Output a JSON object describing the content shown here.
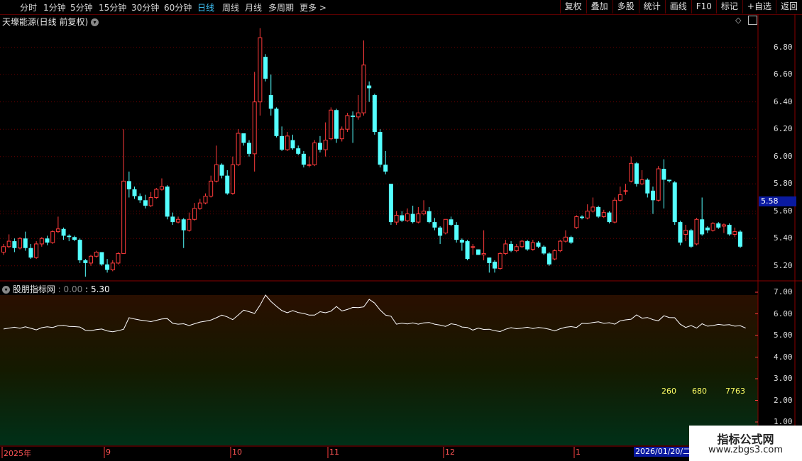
{
  "periods": [
    {
      "label": "分时",
      "active": false
    },
    {
      "label": "1分钟",
      "active": false
    },
    {
      "label": "5分钟",
      "active": false
    },
    {
      "label": "15分钟",
      "active": false
    },
    {
      "label": "30分钟",
      "active": false
    },
    {
      "label": "60分钟",
      "active": false
    },
    {
      "label": "日线",
      "active": true
    },
    {
      "label": "周线",
      "active": false
    },
    {
      "label": "月线",
      "active": false
    },
    {
      "label": "多周期",
      "active": false
    },
    {
      "label": "更多 >",
      "active": false
    }
  ],
  "toolbar_right": [
    "复权",
    "叠加",
    "多股",
    "统计",
    "画线",
    "F10",
    "标记",
    "+自选",
    "返回"
  ],
  "stock_title": "天壕能源(日线 前复权)",
  "price_axis": [
    "6.80",
    "6.60",
    "6.40",
    "6.20",
    "6.00",
    "5.80",
    "5.60",
    "5.40",
    "5.20"
  ],
  "current_price_label": "5.58",
  "indicator": {
    "name": "股朋指标网",
    "value1": "0.00",
    "value2": "5.30"
  },
  "indicator_axis": [
    "7.00",
    "6.00",
    "5.00",
    "4.00",
    "3.00",
    "2.00",
    "1.00"
  ],
  "stats": [
    "260",
    "680",
    "7763"
  ],
  "x_axis": [
    "2025年",
    "9",
    "10",
    "11",
    "12",
    "1"
  ],
  "current_date": "2026/01/20/二",
  "watermark": {
    "line1": "指标公式网",
    "line2": "www.zbgs3.com"
  },
  "colors": {
    "up": "#ff3b3b",
    "down": "#54ffff",
    "line": "#ffffff",
    "accent": "#41c8ff"
  },
  "chart_data": {
    "type": "candlestick",
    "ylim": [
      5.1,
      6.98
    ],
    "indicator_ylim": [
      1.0,
      7.0
    ],
    "candles": [
      [
        5.3,
        5.34,
        5.28,
        5.36
      ],
      [
        5.34,
        5.38,
        5.33,
        5.43
      ],
      [
        5.38,
        5.33,
        5.3,
        5.4
      ],
      [
        5.33,
        5.4,
        5.32,
        5.41
      ],
      [
        5.4,
        5.33,
        5.31,
        5.45
      ],
      [
        5.33,
        5.26,
        5.25,
        5.36
      ],
      [
        5.26,
        5.36,
        5.25,
        5.38
      ],
      [
        5.36,
        5.4,
        5.34,
        5.41
      ],
      [
        5.4,
        5.37,
        5.35,
        5.42
      ],
      [
        5.37,
        5.45,
        5.36,
        5.46
      ],
      [
        5.45,
        5.47,
        5.44,
        5.56
      ],
      [
        5.47,
        5.42,
        5.39,
        5.48
      ],
      [
        5.42,
        5.41,
        5.38,
        5.43
      ],
      [
        5.41,
        5.39,
        5.38,
        5.42
      ],
      [
        5.39,
        5.24,
        5.22,
        5.4
      ],
      [
        5.24,
        5.22,
        5.12,
        5.25
      ],
      [
        5.22,
        5.27,
        5.2,
        5.28
      ],
      [
        5.27,
        5.3,
        5.26,
        5.31
      ],
      [
        5.3,
        5.21,
        5.2,
        5.3
      ],
      [
        5.21,
        5.17,
        5.15,
        5.25
      ],
      [
        5.17,
        5.22,
        5.16,
        5.24
      ],
      [
        5.22,
        5.29,
        5.21,
        5.3
      ],
      [
        5.29,
        5.82,
        5.42,
        6.2
      ],
      [
        5.82,
        5.76,
        5.7,
        5.89
      ],
      [
        5.76,
        5.71,
        5.69,
        5.78
      ],
      [
        5.71,
        5.68,
        5.66,
        5.73
      ],
      [
        5.68,
        5.64,
        5.62,
        5.72
      ],
      [
        5.64,
        5.7,
        5.63,
        5.74
      ],
      [
        5.7,
        5.76,
        5.69,
        5.77
      ],
      [
        5.76,
        5.78,
        5.75,
        5.84
      ],
      [
        5.78,
        5.56,
        5.54,
        5.79
      ],
      [
        5.56,
        5.52,
        5.5,
        5.59
      ],
      [
        5.52,
        5.54,
        5.51,
        5.56
      ],
      [
        5.54,
        5.46,
        5.33,
        5.55
      ],
      [
        5.46,
        5.54,
        5.45,
        5.59
      ],
      [
        5.54,
        5.62,
        5.53,
        5.66
      ],
      [
        5.62,
        5.66,
        5.61,
        5.69
      ],
      [
        5.66,
        5.71,
        5.65,
        5.73
      ],
      [
        5.71,
        5.82,
        5.7,
        5.86
      ],
      [
        5.82,
        5.94,
        5.81,
        6.08
      ],
      [
        5.94,
        5.86,
        5.84,
        5.95
      ],
      [
        5.86,
        5.73,
        5.72,
        5.9
      ],
      [
        5.73,
        5.94,
        5.72,
        6.0
      ],
      [
        5.94,
        6.17,
        5.93,
        6.2
      ],
      [
        6.17,
        6.1,
        6.08,
        6.17
      ],
      [
        6.1,
        6.02,
        6.0,
        6.12
      ],
      [
        6.02,
        6.4,
        5.89,
        6.62
      ],
      [
        6.4,
        6.87,
        6.3,
        6.94
      ],
      [
        6.73,
        6.57,
        6.55,
        6.75
      ],
      [
        6.45,
        6.35,
        6.3,
        6.6
      ],
      [
        6.35,
        6.15,
        6.14,
        6.36
      ],
      [
        6.15,
        6.05,
        6.04,
        6.22
      ],
      [
        6.05,
        6.15,
        6.04,
        6.18
      ],
      [
        6.12,
        6.06,
        6.05,
        6.16
      ],
      [
        6.06,
        6.02,
        6.01,
        6.08
      ],
      [
        6.02,
        5.94,
        5.92,
        6.04
      ],
      [
        5.94,
        5.94,
        5.92,
        6.0
      ],
      [
        5.94,
        6.1,
        5.93,
        6.12
      ],
      [
        6.1,
        6.05,
        6.03,
        6.15
      ],
      [
        6.05,
        6.12,
        6.0,
        6.25
      ],
      [
        6.13,
        6.34,
        6.12,
        6.36
      ],
      [
        6.34,
        6.13,
        6.1,
        6.35
      ],
      [
        6.13,
        6.2,
        6.11,
        6.22
      ],
      [
        6.2,
        6.3,
        6.18,
        6.32
      ],
      [
        6.3,
        6.29,
        6.1,
        6.33
      ],
      [
        6.29,
        6.32,
        6.27,
        6.45
      ],
      [
        6.32,
        6.67,
        6.3,
        6.85
      ],
      [
        6.52,
        6.5,
        6.4,
        6.55
      ],
      [
        6.45,
        6.18,
        6.16,
        6.46
      ],
      [
        6.18,
        5.94,
        5.92,
        6.2
      ],
      [
        5.94,
        5.89,
        5.87,
        6.04
      ],
      [
        5.8,
        5.52,
        5.5,
        5.8
      ],
      [
        5.52,
        5.57,
        5.5,
        5.6
      ],
      [
        5.57,
        5.53,
        5.52,
        5.6
      ],
      [
        5.53,
        5.58,
        5.52,
        5.62
      ],
      [
        5.58,
        5.52,
        5.51,
        5.64
      ],
      [
        5.52,
        5.58,
        5.51,
        5.63
      ],
      [
        5.58,
        5.6,
        5.57,
        5.68
      ],
      [
        5.6,
        5.52,
        5.51,
        5.63
      ],
      [
        5.52,
        5.48,
        5.46,
        5.55
      ],
      [
        5.48,
        5.42,
        5.36,
        5.49
      ],
      [
        5.44,
        5.54,
        5.43,
        5.54
      ],
      [
        5.54,
        5.5,
        5.49,
        5.56
      ],
      [
        5.5,
        5.39,
        5.37,
        5.52
      ],
      [
        5.39,
        5.37,
        5.31,
        5.4
      ],
      [
        5.38,
        5.25,
        5.24,
        5.39
      ],
      [
        5.34,
        5.34,
        5.28,
        5.36
      ],
      [
        5.32,
        5.28,
        5.28,
        5.32
      ],
      [
        5.28,
        5.29,
        5.24,
        5.46
      ],
      [
        5.26,
        5.22,
        5.15,
        5.26
      ],
      [
        5.23,
        5.18,
        5.15,
        5.24
      ],
      [
        5.18,
        5.29,
        5.17,
        5.3
      ],
      [
        5.29,
        5.36,
        5.28,
        5.39
      ],
      [
        5.36,
        5.31,
        5.3,
        5.38
      ],
      [
        5.31,
        5.34,
        5.3,
        5.36
      ],
      [
        5.34,
        5.38,
        5.33,
        5.39
      ],
      [
        5.38,
        5.32,
        5.31,
        5.39
      ],
      [
        5.32,
        5.37,
        5.31,
        5.39
      ],
      [
        5.37,
        5.34,
        5.33,
        5.38
      ],
      [
        5.34,
        5.29,
        5.28,
        5.35
      ],
      [
        5.29,
        5.21,
        5.2,
        5.3
      ],
      [
        5.25,
        5.31,
        5.24,
        5.32
      ],
      [
        5.31,
        5.38,
        5.3,
        5.39
      ],
      [
        5.38,
        5.41,
        5.37,
        5.46
      ],
      [
        5.41,
        5.37,
        5.36,
        5.42
      ],
      [
        5.48,
        5.56,
        5.47,
        5.57
      ],
      [
        5.56,
        5.55,
        5.54,
        5.57
      ],
      [
        5.55,
        5.6,
        5.54,
        5.65
      ],
      [
        5.6,
        5.63,
        5.59,
        5.7
      ],
      [
        5.63,
        5.56,
        5.55,
        5.64
      ],
      [
        5.56,
        5.59,
        5.55,
        5.61
      ],
      [
        5.59,
        5.52,
        5.51,
        5.6
      ],
      [
        5.52,
        5.68,
        5.51,
        5.7
      ],
      [
        5.68,
        5.72,
        5.67,
        5.78
      ],
      [
        5.75,
        5.75,
        5.72,
        5.8
      ],
      [
        5.82,
        5.95,
        5.81,
        6.0
      ],
      [
        5.95,
        5.8,
        5.78,
        5.96
      ],
      [
        5.8,
        5.83,
        5.79,
        5.9
      ],
      [
        5.83,
        5.73,
        5.7,
        5.84
      ],
      [
        5.75,
        5.68,
        5.58,
        5.78
      ],
      [
        5.68,
        5.91,
        5.67,
        5.93
      ],
      [
        5.91,
        5.83,
        5.62,
        5.98
      ],
      [
        5.83,
        5.82,
        5.81,
        5.83
      ],
      [
        5.81,
        5.52,
        5.5,
        5.82
      ],
      [
        5.52,
        5.37,
        5.35,
        5.53
      ],
      [
        5.43,
        5.46,
        5.38,
        5.5
      ],
      [
        5.46,
        5.34,
        5.33,
        5.47
      ],
      [
        5.36,
        5.54,
        5.35,
        5.55
      ],
      [
        5.54,
        5.43,
        5.42,
        5.7
      ],
      [
        5.48,
        5.46,
        5.44,
        5.49
      ],
      [
        5.46,
        5.51,
        5.45,
        5.52
      ],
      [
        5.51,
        5.48,
        5.47,
        5.52
      ],
      [
        5.49,
        5.5,
        5.44,
        5.51
      ],
      [
        5.5,
        5.43,
        5.42,
        5.51
      ],
      [
        5.43,
        5.45,
        5.41,
        5.48
      ],
      [
        5.45,
        5.34,
        5.33,
        5.46
      ]
    ],
    "indicator_series": [
      5.3,
      5.34,
      5.38,
      5.33,
      5.4,
      5.33,
      5.26,
      5.36,
      5.4,
      5.37,
      5.45,
      5.47,
      5.42,
      5.41,
      5.39,
      5.24,
      5.22,
      5.27,
      5.3,
      5.21,
      5.17,
      5.22,
      5.29,
      5.82,
      5.76,
      5.71,
      5.68,
      5.64,
      5.7,
      5.76,
      5.78,
      5.56,
      5.52,
      5.54,
      5.46,
      5.54,
      5.62,
      5.66,
      5.71,
      5.82,
      5.94,
      5.86,
      5.73,
      5.94,
      6.17,
      6.1,
      6.02,
      6.4,
      6.87,
      6.57,
      6.35,
      6.15,
      6.05,
      6.15,
      6.06,
      6.02,
      5.94,
      5.94,
      6.1,
      6.05,
      6.12,
      6.34,
      6.13,
      6.2,
      6.3,
      6.29,
      6.32,
      6.67,
      6.5,
      6.18,
      5.94,
      5.89,
      5.52,
      5.57,
      5.53,
      5.58,
      5.52,
      5.58,
      5.6,
      5.52,
      5.48,
      5.42,
      5.54,
      5.5,
      5.39,
      5.37,
      5.25,
      5.34,
      5.28,
      5.29,
      5.22,
      5.18,
      5.29,
      5.36,
      5.31,
      5.34,
      5.38,
      5.32,
      5.37,
      5.34,
      5.29,
      5.21,
      5.31,
      5.38,
      5.41,
      5.37,
      5.56,
      5.55,
      5.6,
      5.63,
      5.56,
      5.59,
      5.52,
      5.68,
      5.72,
      5.75,
      5.95,
      5.8,
      5.83,
      5.73,
      5.68,
      5.91,
      5.83,
      5.82,
      5.52,
      5.37,
      5.46,
      5.34,
      5.54,
      5.43,
      5.46,
      5.51,
      5.48,
      5.5,
      5.43,
      5.45,
      5.34
    ]
  }
}
